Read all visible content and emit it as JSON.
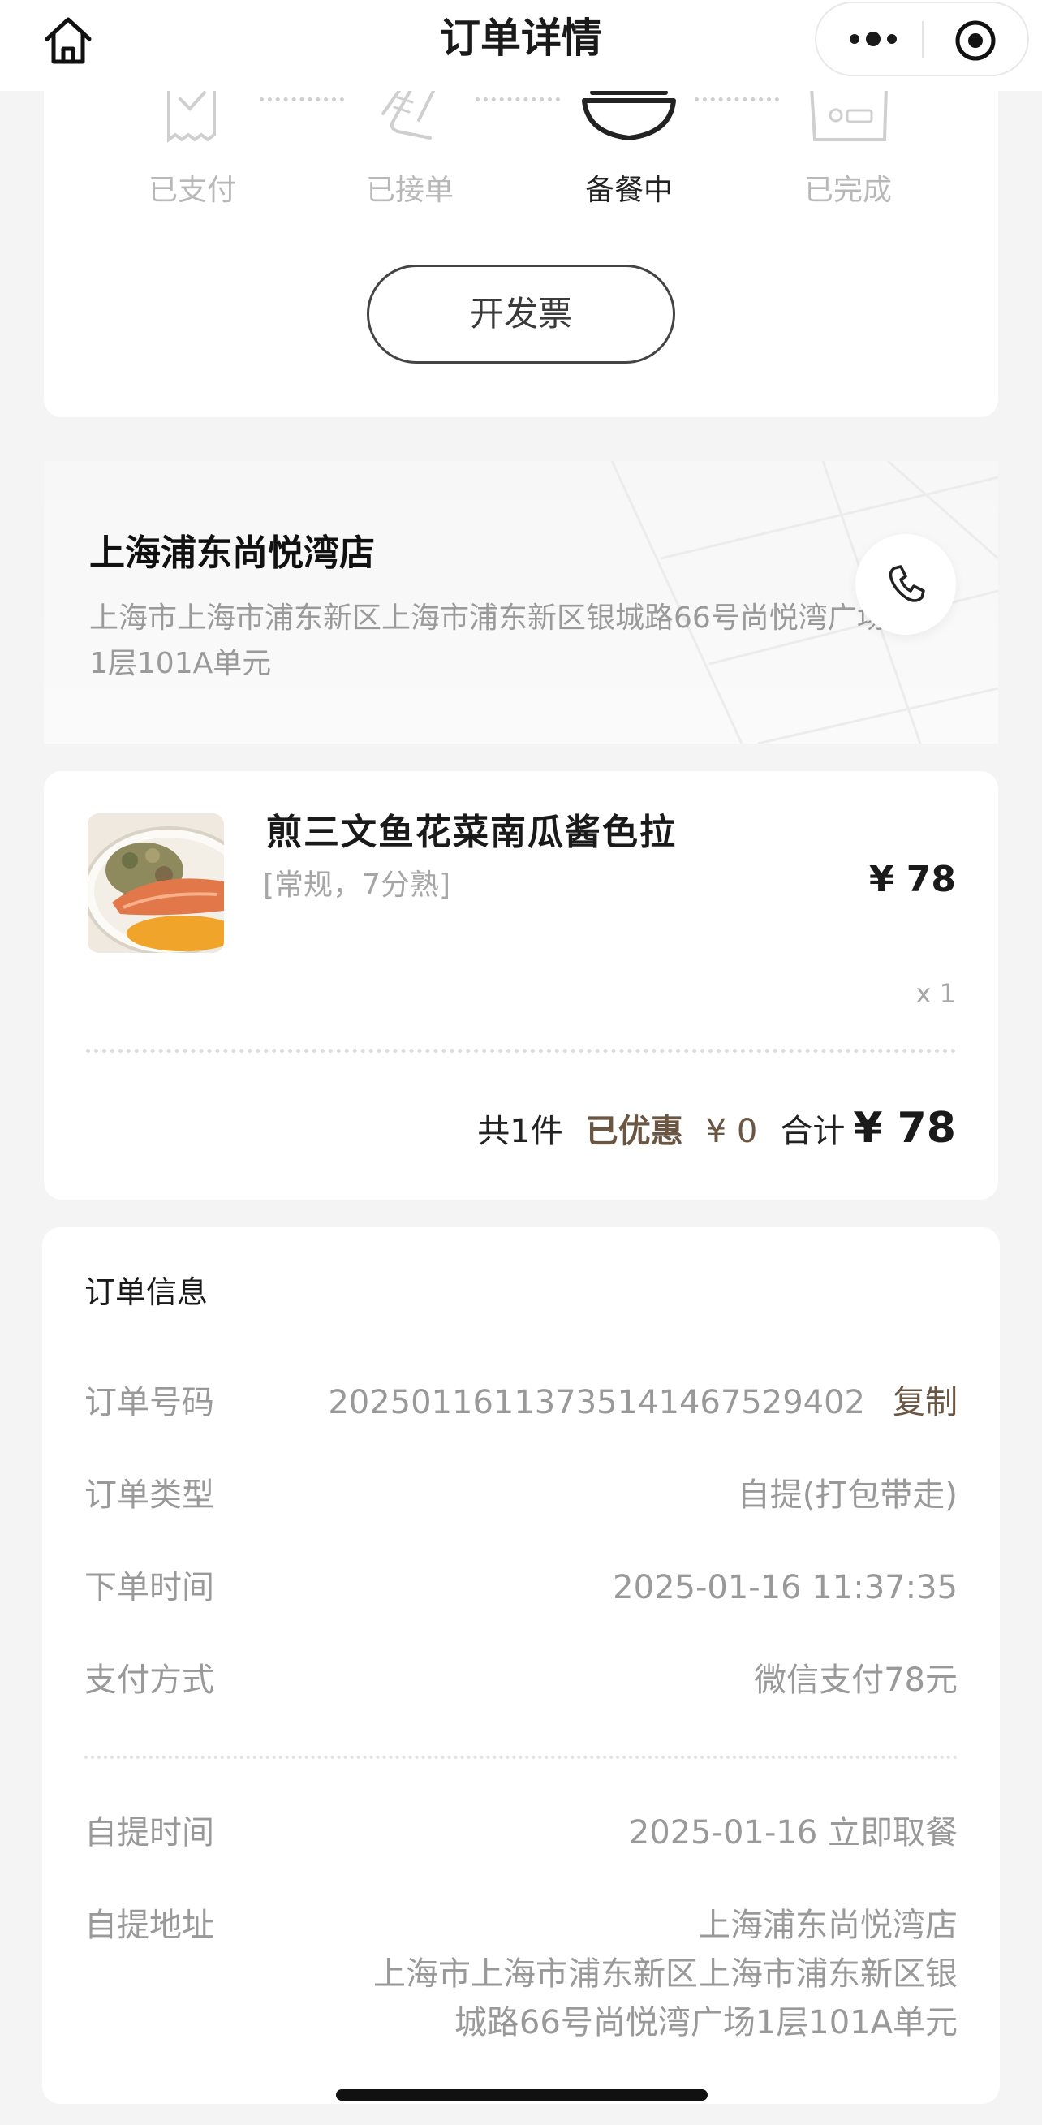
{
  "nav": {
    "title": "订单详情",
    "icons": {
      "home": "home-icon",
      "more": "more-dots-icon",
      "close": "target-close-icon"
    }
  },
  "progress": {
    "steps": [
      {
        "label": "已支付",
        "icon": "receipt-check-icon",
        "active": false
      },
      {
        "label": "已接单",
        "icon": "receipt-curl-icon",
        "active": false
      },
      {
        "label": "备餐中",
        "icon": "bowl-icon",
        "active": true
      },
      {
        "label": "已完成",
        "icon": "bag-done-icon",
        "active": false
      }
    ],
    "invoice_label": "开发票"
  },
  "store": {
    "name": "上海浦东尚悦湾店",
    "address": "上海市上海市浦东新区上海市浦东新区银城路66号尚悦湾广场1层101A单元",
    "phone_icon": "phone-icon"
  },
  "item": {
    "name": "煎三文鱼花菜南瓜酱色拉",
    "spec": "[常规，7分熟]",
    "price": "¥ 78",
    "qty": "x 1",
    "image": "salmon-salad-photo"
  },
  "totals": {
    "count": "共1件",
    "discount_label": "已优惠",
    "discount_value": "¥ 0",
    "sum_label": "合计",
    "sum_value": "¥ 78"
  },
  "info": {
    "title": "订单信息",
    "order_no_label": "订单号码",
    "order_no_value": "20250116113735141467529402",
    "copy_label": "复制",
    "type_label": "订单类型",
    "type_value": "自提(打包带走)",
    "time_label": "下单时间",
    "time_value": "2025-01-16 11:37:35",
    "pay_label": "支付方式",
    "pay_value": "微信支付78元",
    "pickup_time_label": "自提时间",
    "pickup_time_value": "2025-01-16 立即取餐",
    "pickup_addr_label": "自提地址",
    "pickup_addr_store": "上海浦东尚悦湾店",
    "pickup_addr_line1": "上海市上海市浦东新区上海市浦东新区银",
    "pickup_addr_line2": "城路66号尚悦湾广场1层101A单元"
  }
}
